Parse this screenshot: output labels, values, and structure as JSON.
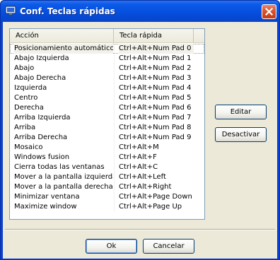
{
  "window": {
    "title": "Conf. Teclas rápidas",
    "colors": {
      "titlebar": "#0b5ae8",
      "client": "#ece9d8",
      "close": "#d9532e"
    }
  },
  "table": {
    "columns": [
      "Acción",
      "Tecla rápida"
    ],
    "rows": [
      {
        "action": "Posicionamiento automático",
        "key": "Ctrl+Alt+Num Pad 0"
      },
      {
        "action": "Abajo Izquierda",
        "key": "Ctrl+Alt+Num Pad 1"
      },
      {
        "action": "Abajo",
        "key": "Ctrl+Alt+Num Pad 2"
      },
      {
        "action": "Abajo Derecha",
        "key": "Ctrl+Alt+Num Pad 3"
      },
      {
        "action": "Izquierda",
        "key": "Ctrl+Alt+Num Pad 4"
      },
      {
        "action": "Centro",
        "key": "Ctrl+Alt+Num Pad 5"
      },
      {
        "action": "Derecha",
        "key": "Ctrl+Alt+Num Pad 6"
      },
      {
        "action": "Arriba Izquierda",
        "key": "Ctrl+Alt+Num Pad 7"
      },
      {
        "action": "Arriba",
        "key": "Ctrl+Alt+Num Pad 8"
      },
      {
        "action": "Arriba Derecha",
        "key": "Ctrl+Alt+Num Pad 9"
      },
      {
        "action": "Mosaico",
        "key": "Ctrl+Alt+M"
      },
      {
        "action": "Windows fusion",
        "key": "Ctrl+Alt+F"
      },
      {
        "action": "Cierra todas las ventanas",
        "key": "Ctrl+Alt+C"
      },
      {
        "action": "Mover a la pantalla izquierda",
        "key": "Ctrl+Alt+Left"
      },
      {
        "action": "Mover a la pantalla derecha",
        "key": "Ctrl+Alt+Right"
      },
      {
        "action": "Minimizar ventana",
        "key": "Ctrl+Alt+Page Down"
      },
      {
        "action": "Maximize window",
        "key": "Ctrl+Alt+Page Up"
      }
    ]
  },
  "side_buttons": {
    "edit_label": "Editar",
    "disable_label": "Desactivar"
  },
  "footer_buttons": {
    "ok_label": "Ok",
    "cancel_label": "Cancelar"
  },
  "icons": {
    "app": "monitor-icon",
    "close": "close-icon"
  }
}
